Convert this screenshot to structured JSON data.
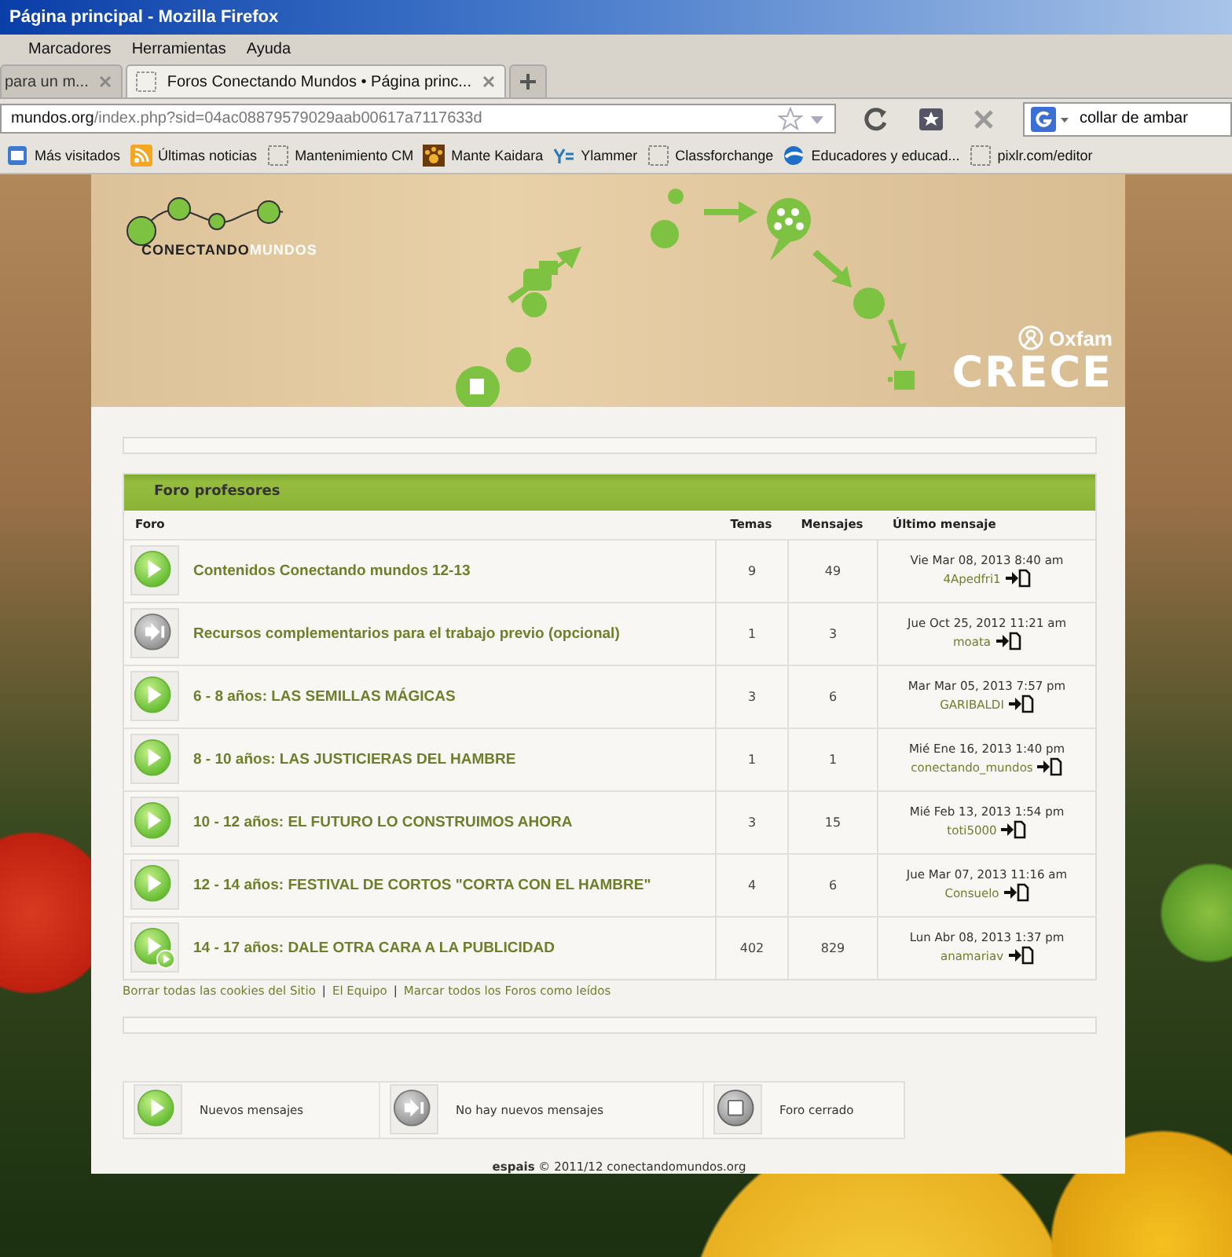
{
  "browser": {
    "window_title": "Página principal - Mozilla Firefox",
    "menu": [
      "Marcadores",
      "Herramientas",
      "Ayuda"
    ],
    "tabs": [
      {
        "label": "para un m...",
        "selected": false
      },
      {
        "label": "Foros Conectando Mundos • Página princ...",
        "selected": true
      }
    ],
    "url_host": "mundos.org",
    "url_path": "/index.php?sid=04ac08879579029aab00617a7117633d",
    "search": "collar de ambar",
    "bookmarks": [
      {
        "label": "Más visitados",
        "kind": "browser"
      },
      {
        "label": "Últimas noticias",
        "kind": "feed"
      },
      {
        "label": "Mantenimiento CM",
        "kind": "blank"
      },
      {
        "label": "Mante Kaidara",
        "kind": "paw"
      },
      {
        "label": "Ylammer",
        "kind": "yammer"
      },
      {
        "label": "Classforchange",
        "kind": "blank"
      },
      {
        "label": "Educadores y educad...",
        "kind": "globe"
      },
      {
        "label": "pixlr.com/editor",
        "kind": "blank"
      }
    ]
  },
  "banner": {
    "logo_first": "CONECTANDO",
    "logo_second": "MUNDOS",
    "partner": "Oxfam",
    "campaign": "CRECE"
  },
  "forum": {
    "title": "Foro profesores",
    "columns": [
      "Foro",
      "Temas",
      "Mensajes",
      "Último mensaje"
    ],
    "rows": [
      {
        "kind": "new",
        "title": "Contenidos Conectando mundos 12-13",
        "topics": "9",
        "posts": "49",
        "last_date": "Vie Mar 08, 2013 8:40 am",
        "last_user": "4Apedfri1"
      },
      {
        "kind": "none",
        "title": "Recursos complementarios para el trabajo previo (opcional)",
        "topics": "1",
        "posts": "3",
        "last_date": "Jue Oct 25, 2012 11:21 am",
        "last_user": "moata"
      },
      {
        "kind": "new",
        "title": "6 - 8 años: LAS SEMILLAS MÁGICAS",
        "topics": "3",
        "posts": "6",
        "last_date": "Mar Mar 05, 2013 7:57 pm",
        "last_user": "GARIBALDI"
      },
      {
        "kind": "new",
        "title": "8 - 10 años: LAS JUSTICIERAS DEL HAMBRE",
        "topics": "1",
        "posts": "1",
        "last_date": "Mié Ene 16, 2013 1:40 pm",
        "last_user": "conectando_mundos"
      },
      {
        "kind": "new",
        "title": "10 - 12 años: EL FUTURO LO CONSTRUIMOS AHORA",
        "topics": "3",
        "posts": "15",
        "last_date": "Mié Feb 13, 2013 1:54 pm",
        "last_user": "toti5000"
      },
      {
        "kind": "new",
        "title": "12 - 14 años: FESTIVAL DE CORTOS \"CORTA CON EL HAMBRE\"",
        "topics": "4",
        "posts": "6",
        "last_date": "Jue Mar 07, 2013 11:16 am",
        "last_user": "Consuelo"
      },
      {
        "kind": "new_subforum",
        "title": "14 - 17 años: DALE OTRA CARA A LA PUBLICIDAD",
        "topics": "402",
        "posts": "829",
        "last_date": "Lun Abr 08, 2013 1:37 pm",
        "last_user": "anamariav"
      }
    ]
  },
  "links": [
    "Borrar todas las cookies del Sitio",
    "El Equipo",
    "Marcar todos los Foros como leídos"
  ],
  "link_separator": "|",
  "legend": [
    {
      "kind": "new",
      "label": "Nuevos mensajes"
    },
    {
      "kind": "none",
      "label": "No hay nuevos mensajes"
    },
    {
      "kind": "locked",
      "label": "Foro cerrado"
    }
  ],
  "footer": "**espais** © 2011/12 conectandomundos.org"
}
